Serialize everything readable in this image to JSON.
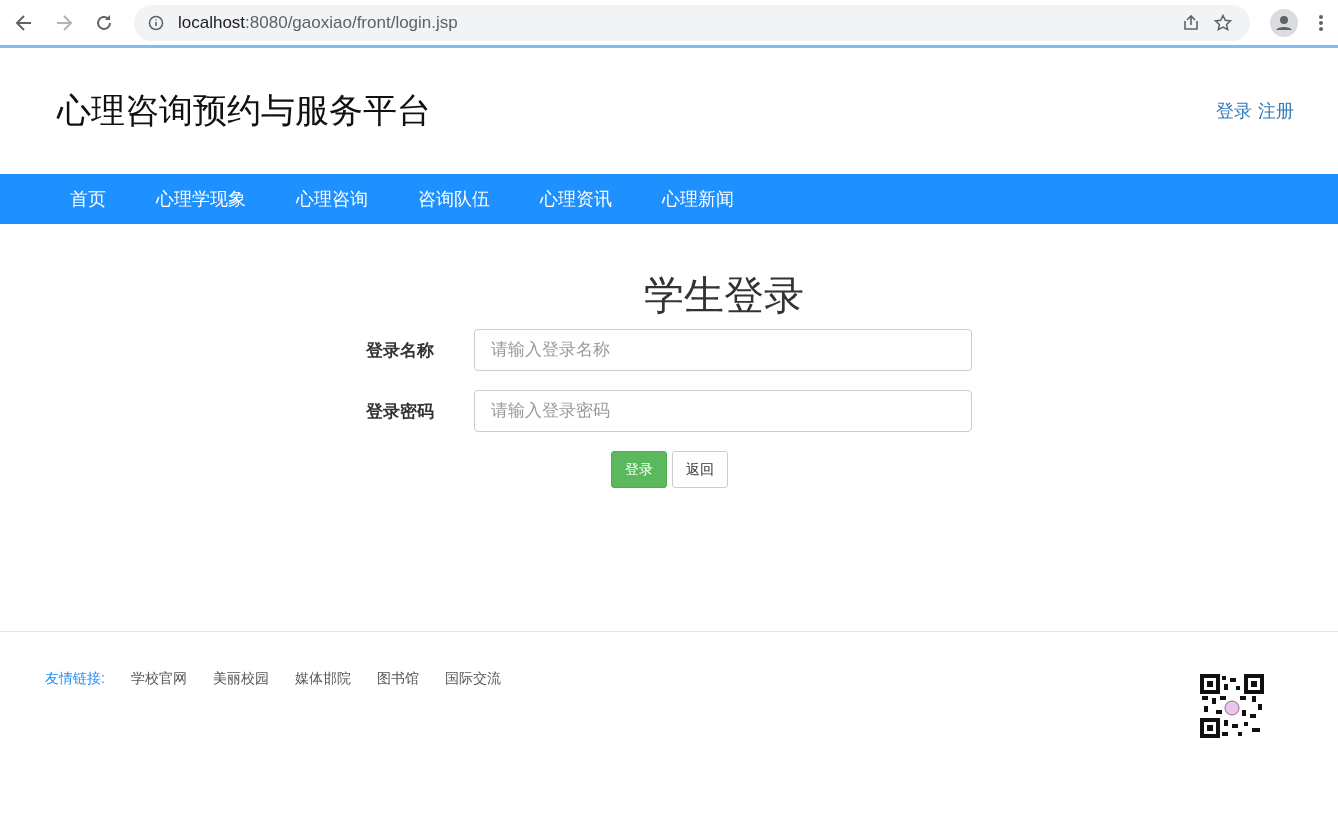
{
  "browser": {
    "url_host": "localhost",
    "url_rest": ":8080/gaoxiao/front/login.jsp"
  },
  "header": {
    "site_title": "心理咨询预约与服务平台",
    "links": [
      "登录",
      "注册"
    ]
  },
  "nav": {
    "items": [
      "首页",
      "心理学现象",
      "心理咨询",
      "咨询队伍",
      "心理资讯",
      "心理新闻"
    ]
  },
  "login": {
    "title": "学生登录",
    "fields": [
      {
        "label": "登录名称",
        "placeholder": "请输入登录名称"
      },
      {
        "label": "登录密码",
        "placeholder": "请输入登录密码"
      }
    ],
    "buttons": [
      {
        "label": "登录",
        "kind": "primary"
      },
      {
        "label": "返回",
        "kind": "default"
      }
    ]
  },
  "footer": {
    "links_label": "友情链接:",
    "links": [
      "学校官网",
      "美丽校园",
      "媒体邯院",
      "图书馆",
      "国际交流"
    ]
  }
}
